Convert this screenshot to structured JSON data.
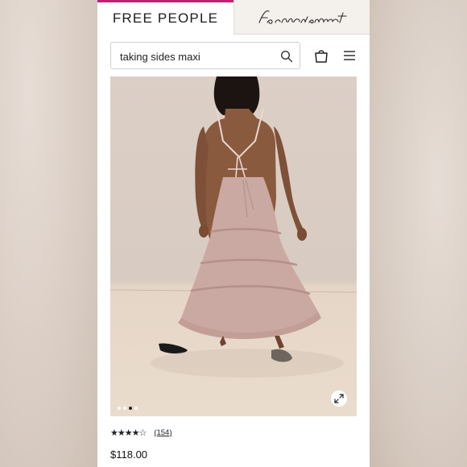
{
  "header": {
    "brand_tab": "FREE PEOPLE",
    "movement_tab": "fpmovement"
  },
  "search": {
    "value": "taking sides maxi",
    "placeholder": "Search"
  },
  "gallery": {
    "dot_count": 4,
    "active_dot_index": 2
  },
  "product": {
    "rating_stars": "★★★★☆",
    "rating_value": 4.5,
    "review_count": "(154)",
    "price": "$118.00"
  },
  "colors": {
    "brand_accent": "#c21f6f",
    "dress": "#caa9a3"
  }
}
